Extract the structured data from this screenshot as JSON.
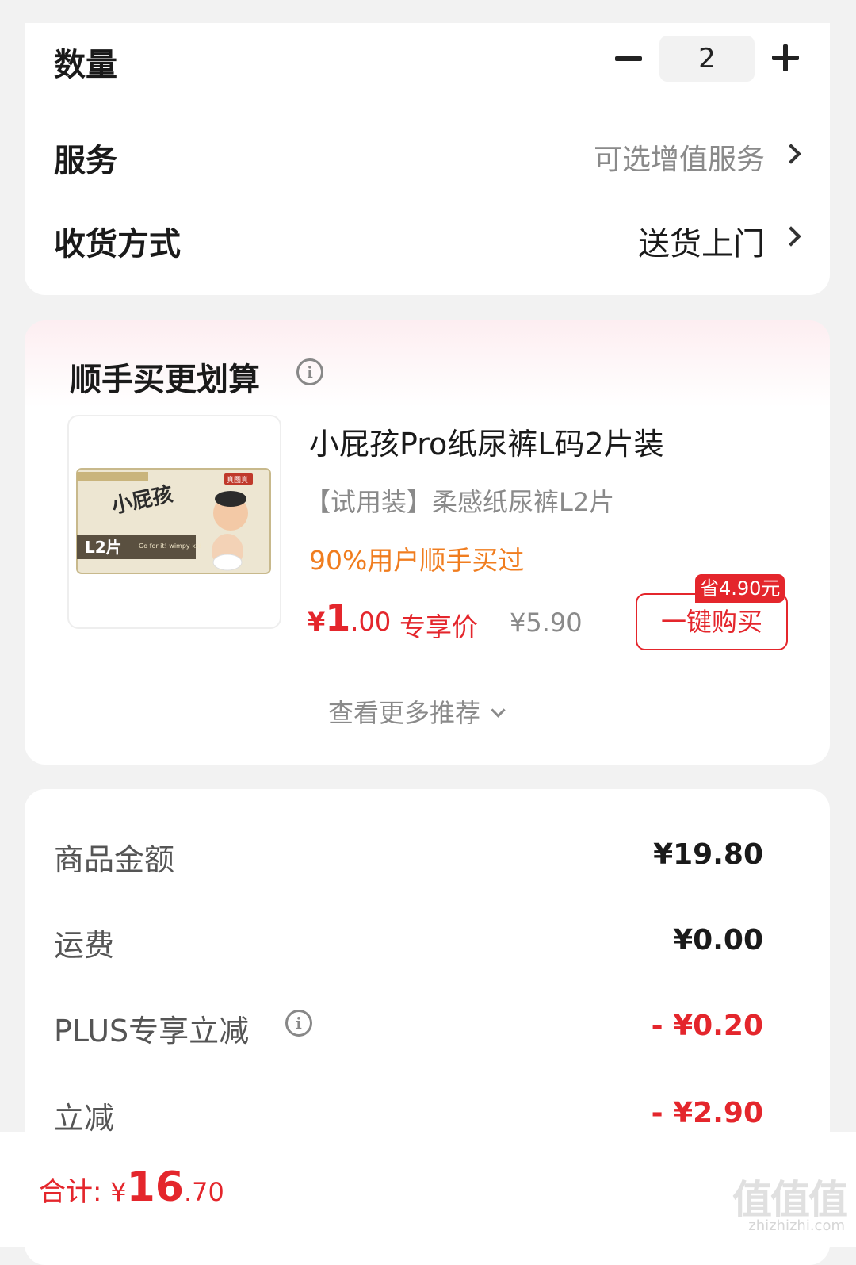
{
  "order_card": {
    "quantity_label": "数量",
    "quantity_value": "2",
    "service_label": "服务",
    "service_value": "可选增值服务",
    "delivery_label": "收货方式",
    "delivery_value": "送货上门"
  },
  "addon": {
    "title": "顺手买更划算",
    "product_name": "小屁孩Pro纸尿裤L码2片装",
    "product_subtitle": "【试用装】柔感纸尿裤L2片",
    "tag": "90%用户顺手买过",
    "price_yen": "¥",
    "price_int": "1",
    "price_dec": ".00",
    "price_label": "专享价",
    "original_price": "¥5.90",
    "save_badge": "省4.90元",
    "buy_button": "一键购买",
    "more_link": "查看更多推荐",
    "thumb_text": {
      "brand": "小屁孩",
      "size": "L2片",
      "slogan": "Go for it! wimpy kid",
      "badge": "真图真"
    }
  },
  "summary": {
    "goods_label": "商品金额",
    "goods_value": "¥19.80",
    "shipping_label": "运费",
    "shipping_value": "¥0.00",
    "plus_label": "PLUS专享立减",
    "plus_value": "- ¥0.20",
    "discount_label": "立减",
    "discount_value": "- ¥2.90"
  },
  "bottom": {
    "total_label": "合计: ",
    "total_yen": "¥",
    "total_int": "16",
    "total_dec": ".70",
    "watermark": "值值值",
    "watermark_url": "zhizhizhi.com"
  },
  "colors": {
    "accent_red": "#e4262c",
    "tag_orange": "#f07d1f",
    "muted_gray": "#8a8a8a",
    "page_bg": "#f2f2f2"
  }
}
